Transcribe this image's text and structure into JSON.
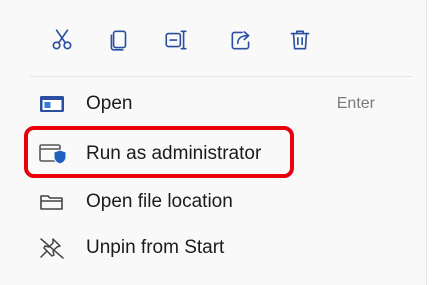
{
  "toolbar": {
    "buttons": [
      {
        "name": "cut",
        "icon": "scissors-icon"
      },
      {
        "name": "copy",
        "icon": "copy-icon"
      },
      {
        "name": "rename",
        "icon": "rename-icon"
      },
      {
        "name": "share",
        "icon": "share-icon"
      },
      {
        "name": "delete",
        "icon": "trash-icon"
      }
    ],
    "accent": "#2a4fa0"
  },
  "items": [
    {
      "label": "Open",
      "shortcut": "Enter",
      "icon": "open-app-icon"
    },
    {
      "label": "Run as administrator",
      "shortcut": "",
      "icon": "shield-admin-icon"
    },
    {
      "label": "Open file location",
      "shortcut": "",
      "icon": "folder-icon"
    },
    {
      "label": "Unpin from Start",
      "shortcut": "",
      "icon": "unpin-icon"
    }
  ],
  "highlight_color": "#e8000d"
}
